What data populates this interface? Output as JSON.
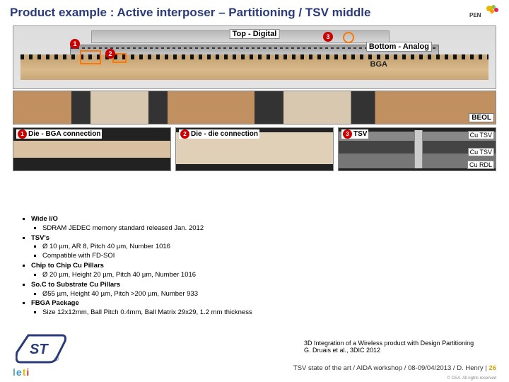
{
  "title": "Product example : Active interposer – Partitioning / TSV middle",
  "cross_section": {
    "top_label": "Top - Digital",
    "bottom_label": "Bottom - Analog",
    "bga_label": "BGA"
  },
  "beol_label": "BEOL",
  "panels": {
    "a": "Die - BGA connection",
    "b": "Die - die connection",
    "c": "TSV",
    "cu_tsv": "Cu TSV",
    "cu_rdl": "Cu RDL"
  },
  "bullets": {
    "b1": "Wide I/O",
    "b1a": "SDRAM JEDEC memory standard released Jan. 2012",
    "b2": "TSV's",
    "b2a": "Ø 10 µm, AR 8, Pitch 40 µm, Number 1016",
    "b2b": "Compatible with FD-SOI",
    "b3": "Chip to Chip Cu Pillars",
    "b3a": "Ø 20 µm, Height 20 µm, Pitch 40 µm, Number 1016",
    "b4": "So.C to Substrate Cu Pillars",
    "b4a": "Ø55 µm, Height 40 µm, Pitch >200 µm, Number 933",
    "b5": "FBGA Package",
    "b5a": "Size 12x12mm, Ball Pitch 0.4mm, Ball Matrix 29x29, 1.2 mm thickness"
  },
  "citation": {
    "line1": "3D Integration of a Wireless product with Design Partitioning",
    "line2": "G. Druais et al., 3DIC 2012"
  },
  "footer": {
    "text": "TSV state of the art / AIDA workshop / 08-09/04/2013 / D. Henry",
    "page": "26"
  },
  "copyright": "© CEA. All rights reserved",
  "leti": {
    "l": "l",
    "e": "e",
    "t": "t",
    "i": "i"
  }
}
